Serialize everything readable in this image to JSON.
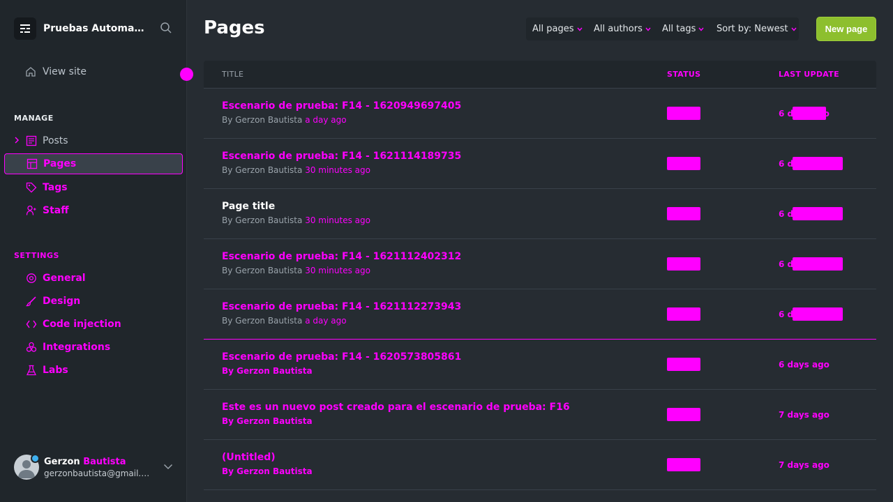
{
  "sidebar": {
    "site_name": "Pruebas Automatizadas",
    "view_site_label": "View site",
    "manage_title": "MANAGE",
    "settings_title": "SETTINGS",
    "manage_items": [
      {
        "label": "Posts",
        "icon": "posts-icon"
      },
      {
        "label": "Pages",
        "icon": "pages-icon"
      },
      {
        "label": "Tags",
        "icon": "tag-icon"
      },
      {
        "label": "Staff",
        "icon": "staff-icon"
      }
    ],
    "settings_items": [
      {
        "label": "General",
        "icon": "gear-icon"
      },
      {
        "label": "Design",
        "icon": "brush-icon"
      },
      {
        "label": "Code injection",
        "icon": "code-icon"
      },
      {
        "label": "Integrations",
        "icon": "integrations-icon"
      },
      {
        "label": "Labs",
        "icon": "flask-icon"
      }
    ],
    "user": {
      "first_name": "Gerzon",
      "last_name": "Bautista",
      "email": "gerzonbautista@gmail.com"
    }
  },
  "header": {
    "title": "Pages",
    "filters": [
      "All pages",
      "All authors",
      "All tags",
      "Sort by: Newest"
    ],
    "new_button": "New page"
  },
  "list": {
    "columns": {
      "title": "TITLE",
      "status": "STATUS",
      "last_update": "LAST UPDATE"
    },
    "rows": [
      {
        "title": "Escenario de prueba: F14 - 1620949697405",
        "by": "By Gerzon Bautista",
        "when": "a day ago",
        "time": "6 days ago"
      },
      {
        "title": "Escenario de prueba: F14 - 1621114189735",
        "by": "By Gerzon Bautista",
        "when": "30 minutes ago",
        "time": "6 days ago"
      },
      {
        "title": "Page title",
        "by": "By Gerzon Bautista",
        "when": "30 minutes ago",
        "time": "6 days ago"
      },
      {
        "title": "Escenario de prueba: F14 - 1621112402312",
        "by": "By Gerzon Bautista",
        "when": "30 minutes ago",
        "time": "6 days ago"
      },
      {
        "title": "Escenario de prueba: F14 - 1621112273943",
        "by": "By Gerzon Bautista",
        "when": "a day ago",
        "time": "6 days ago"
      },
      {
        "title": "Escenario de prueba: F14 - 1620573805861",
        "by": "By Gerzon Bautista",
        "when": "",
        "time": "6 days ago"
      },
      {
        "title": "Este es un nuevo post creado para el escenario de prueba: F16",
        "by": "By Gerzon Bautista",
        "when": "",
        "time": "7 days ago"
      },
      {
        "title": "(Untitled)",
        "by": "By Gerzon Bautista",
        "when": "",
        "time": "7 days ago"
      }
    ]
  },
  "colors": {
    "accent": "#ff00ff",
    "primary_button": "#8dbf2e",
    "background": "#262c32",
    "sidebar": "#20262b"
  }
}
